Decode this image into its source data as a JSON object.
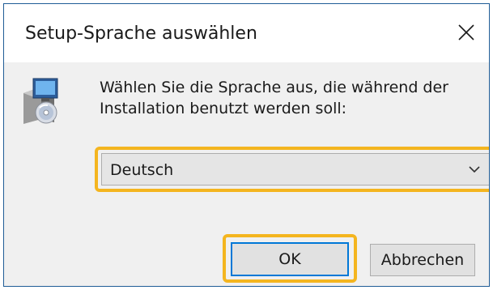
{
  "window": {
    "title": "Setup-Sprache auswählen",
    "close_icon": "close-icon"
  },
  "content": {
    "icon": "setup-installer-icon",
    "message_line1": "Wählen Sie die Sprache aus, die während der",
    "message_line2": "Installation benutzt werden soll:"
  },
  "language_select": {
    "selected": "Deutsch",
    "arrow_icon": "chevron-down-icon"
  },
  "buttons": {
    "ok_label": "OK",
    "cancel_label": "Abbrechen"
  },
  "highlight_color": "#f4b51f",
  "accent_color": "#0078d7"
}
